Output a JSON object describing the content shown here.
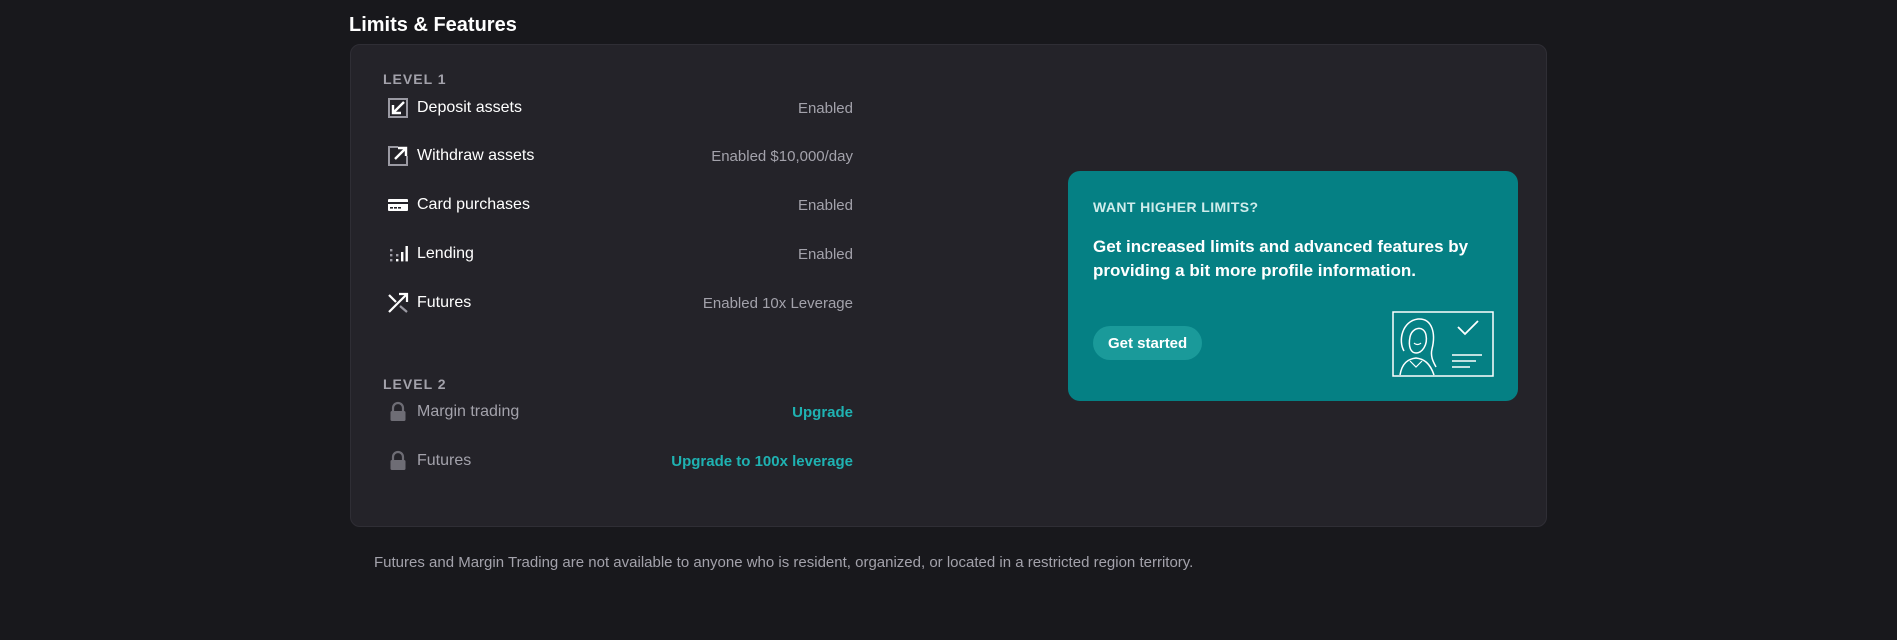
{
  "section": {
    "title": "Limits & Features"
  },
  "level1": {
    "label": "LEVEL 1",
    "items": [
      {
        "icon": "deposit-icon",
        "name": "Deposit assets",
        "value": "Enabled"
      },
      {
        "icon": "withdraw-icon",
        "name": "Withdraw assets",
        "value": "Enabled $10,000/day"
      },
      {
        "icon": "card-icon",
        "name": "Card purchases",
        "value": "Enabled"
      },
      {
        "icon": "lending-icon",
        "name": "Lending",
        "value": "Enabled"
      },
      {
        "icon": "futures-icon",
        "name": "Futures",
        "value": "Enabled 10x Leverage"
      }
    ]
  },
  "level2": {
    "label": "LEVEL 2",
    "items": [
      {
        "icon": "lock-icon",
        "name": "Margin trading",
        "action": "Upgrade"
      },
      {
        "icon": "lock-icon",
        "name": "Futures",
        "action": "Upgrade to 100x leverage"
      }
    ]
  },
  "promo": {
    "eyebrow": "WANT HIGHER LIMITS?",
    "text": "Get increased limits and advanced features by providing a bit more profile information.",
    "button_label": "Get started",
    "illustration": "id-verification-illustration"
  },
  "disclaimer": "Futures and Margin Trading are not available to anyone who is resident, organized, or located in a restricted region territory.",
  "colors": {
    "background": "#18181c",
    "card": "#242329",
    "accent": "#1fb2b2",
    "promo": "#058084",
    "muted_text": "#a3a2ab"
  }
}
